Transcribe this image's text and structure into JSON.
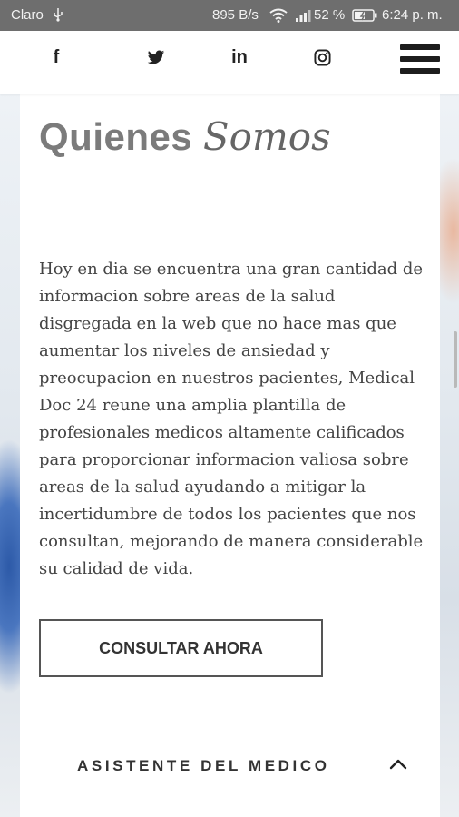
{
  "status_bar": {
    "carrier": "Claro",
    "net_speed": "895 B/s",
    "battery_percent": "52 %",
    "time": "6:24 p. m."
  },
  "social": {
    "icons": [
      "facebook-icon",
      "twitter-icon",
      "linkedin-icon",
      "instagram-icon",
      "menu-icon"
    ],
    "facebook_glyph": "f",
    "linkedin_glyph": "in"
  },
  "section": {
    "title_part1": "Quienes",
    "title_part2": "Somos",
    "body": "Hoy en dia se encuentra una gran cantidad de informacion sobre areas de la salud disgregada en la web que no hace mas que aumentar los niveles de ansiedad y preocupacion en nuestros pacientes, Medical Doc 24 reune una amplia plantilla de profesionales medicos altamente calificados para proporcionar informacion valiosa sobre areas de la salud ayudando a mitigar la incertidumbre de todos los pacientes que nos consultan, mejorando de manera considerable su calidad de vida.",
    "cta_label": "CONSULTAR AHORA"
  },
  "accordion": {
    "label": "ASISTENTE DEL MEDICO",
    "expanded": true
  },
  "colors": {
    "status_bar_bg": "#6e6e6e",
    "title_color": "#7b7b7b",
    "text_color": "#444444",
    "accent_blue": "#2d5aa8"
  }
}
